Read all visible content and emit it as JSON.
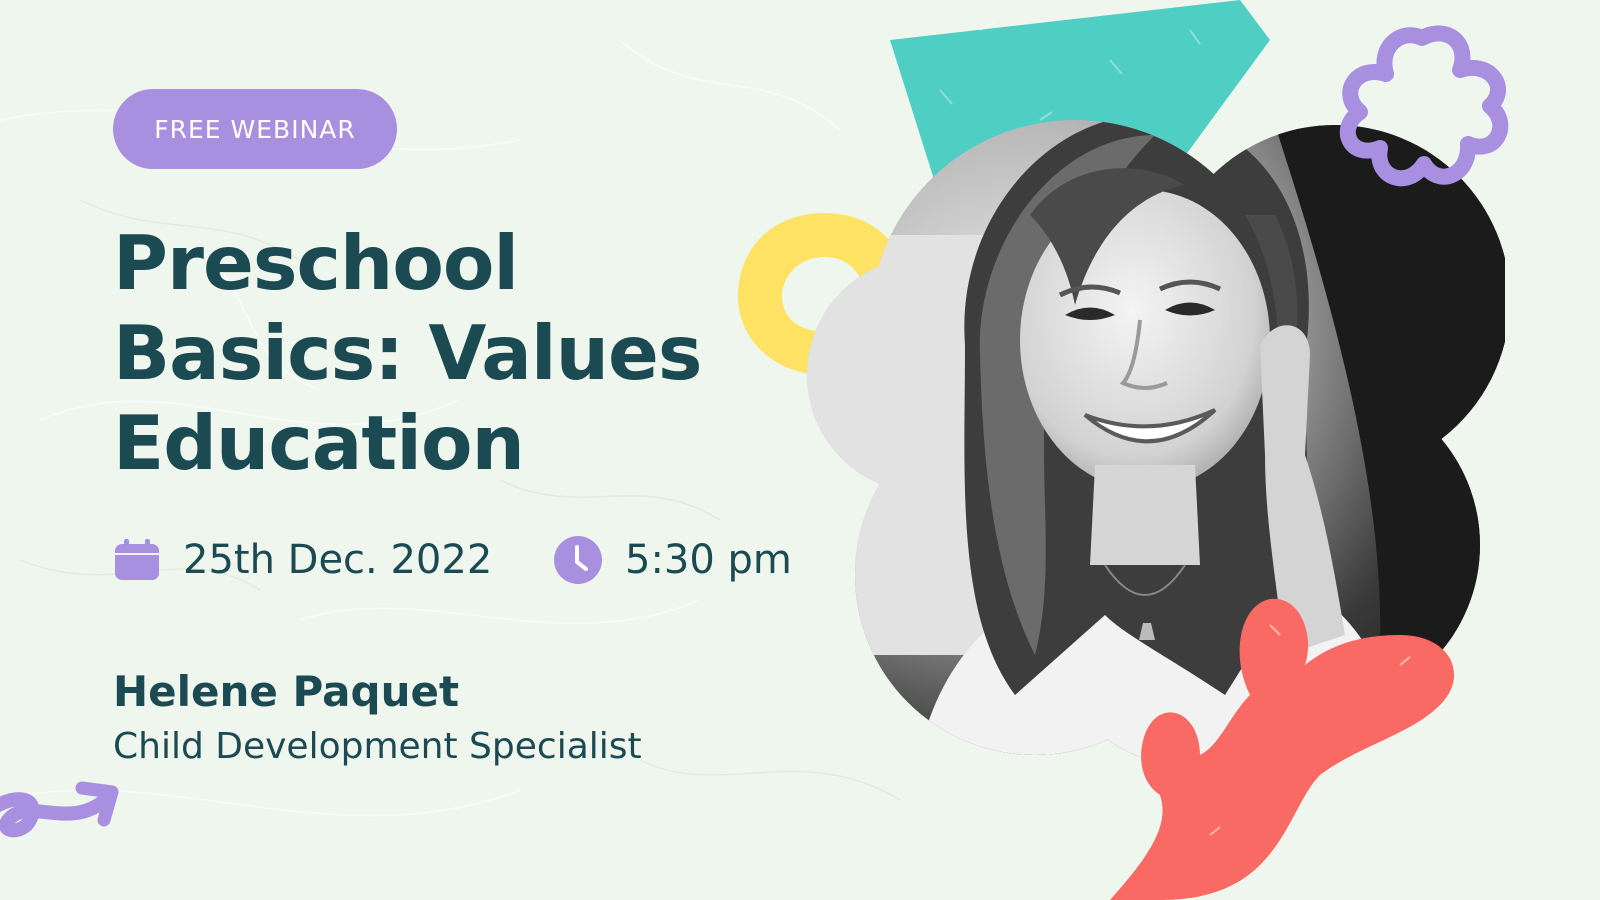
{
  "badge": {
    "label": "FREE WEBINAR"
  },
  "title": {
    "line1": "Preschool",
    "line2": "Basics: Values",
    "line3": "Education"
  },
  "event": {
    "date": "25th Dec. 2022",
    "time": "5:30 pm",
    "date_icon": "calendar-icon",
    "time_icon": "clock-icon"
  },
  "speaker": {
    "name": "Helene Paquet",
    "role": "Child Development Specialist"
  },
  "colors": {
    "background": "#eef6ee",
    "text": "#1c4a52",
    "accent_purple": "#a98fe0",
    "teal": "#4fcfc4",
    "yellow": "#fde263",
    "coral": "#f86a63"
  }
}
